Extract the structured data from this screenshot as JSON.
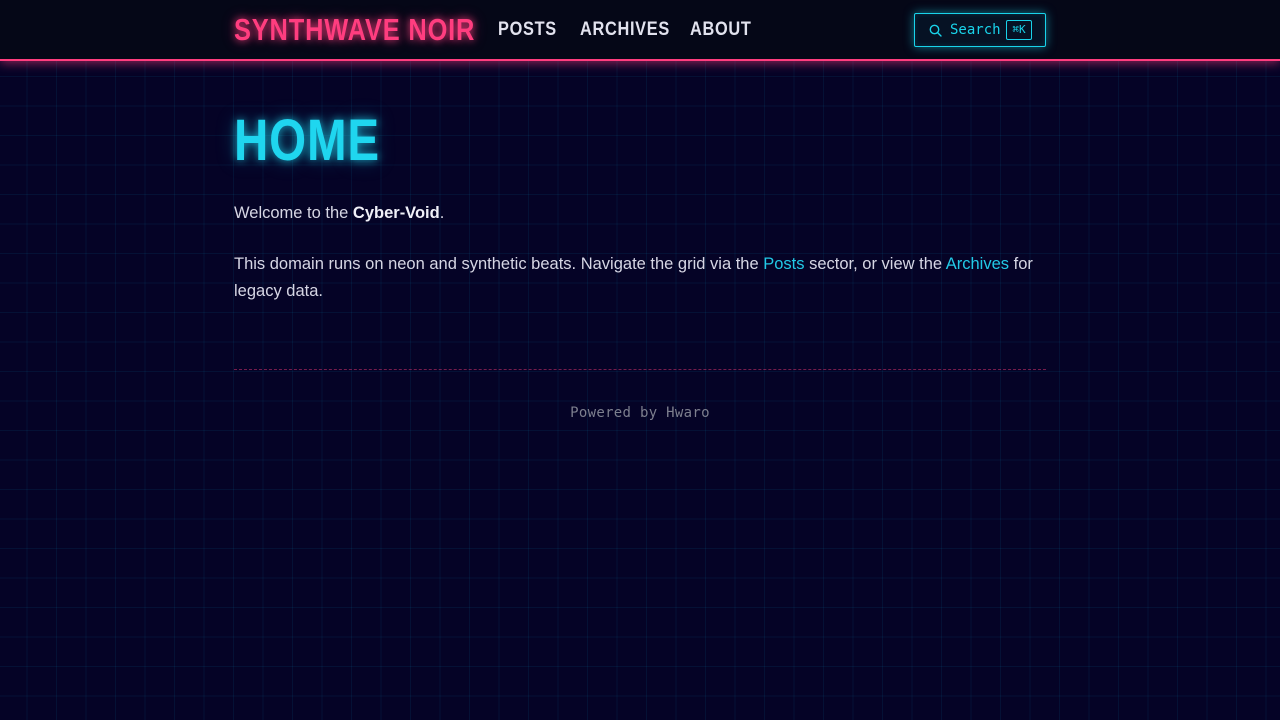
{
  "site": {
    "brand": "SYNTHWAVE NOIR"
  },
  "nav": {
    "items": [
      {
        "label": "POSTS"
      },
      {
        "label": "ARCHIVES"
      },
      {
        "label": "ABOUT"
      }
    ]
  },
  "search": {
    "label": "Search",
    "shortcut": "⌘K",
    "icon": "search-icon"
  },
  "main": {
    "title": "HOME",
    "welcome": {
      "prefix": "Welcome to the ",
      "emphasis": "Cyber-Void",
      "suffix": "."
    },
    "intro": {
      "text_1": "This domain runs on neon and synthetic beats. Navigate the grid via the ",
      "link_posts": "Posts",
      "text_2": " sector, or view the ",
      "link_archives": "Archives",
      "text_3": " for legacy data."
    }
  },
  "footer": {
    "text": "Powered by Hwaro"
  },
  "colors": {
    "accent_pink": "#ff3d7f",
    "accent_cyan": "#1fd6ef",
    "background": "#050326",
    "text": "#d6d6e4"
  }
}
